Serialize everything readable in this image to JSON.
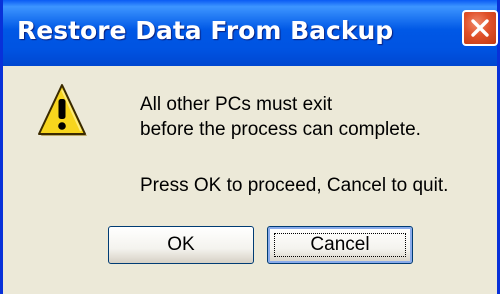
{
  "dialog": {
    "title": "Restore Data From Backup",
    "message_line1": "All other PCs must exit",
    "message_line2": "before the process can complete.",
    "instruction": "Press OK to proceed, Cancel to quit.",
    "icon": "warning-icon"
  },
  "buttons": {
    "ok_label": "OK",
    "cancel_label": "Cancel"
  },
  "colors": {
    "titlebar": "#0058e6",
    "client": "#ece9d8",
    "close": "#e0512a",
    "warning": "#f7d51d"
  }
}
